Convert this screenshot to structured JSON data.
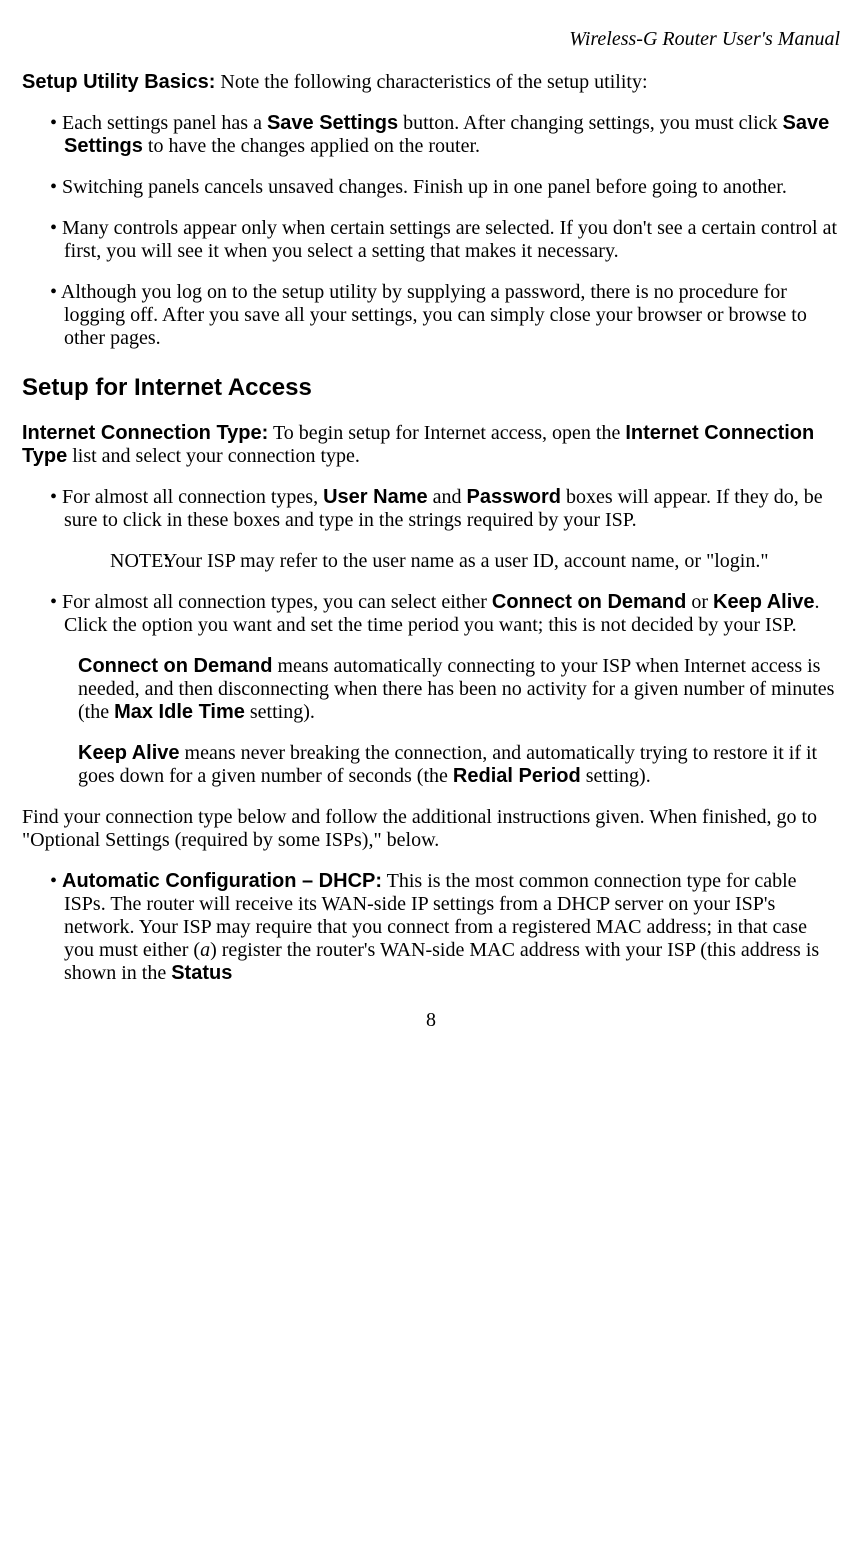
{
  "header": {
    "title": "Wireless-G Router User's Manual"
  },
  "setup_basics": {
    "lead": "Setup Utility Basics:",
    "intro_rest": " Note the following characteristics of the setup utility:",
    "bullets": [
      {
        "pre": "Each settings panel has a ",
        "b1": "Save Settings",
        "mid": " button. After changing settings, you must click ",
        "b2": "Save Settings",
        "post": " to have the changes applied on the router."
      },
      {
        "text": "Switching panels cancels unsaved changes. Finish up in one panel before going to another."
      },
      {
        "text": "Many controls appear only when certain settings are selected. If you don't see a certain control at first, you will see it when you select a setting that makes it necessary."
      },
      {
        "text": "Although you log on to the setup utility by supplying a password, there is no procedure for logging off. After you save all your settings, you can simply close your browser or browse to other pages."
      }
    ]
  },
  "section2": {
    "heading": "Setup for Internet Access",
    "ict": {
      "lead": "Internet Connection Type:",
      "p1a": " To begin setup for Internet access, open the ",
      "b1": "Internet Connection Type",
      "p1b": " list and select your connection type."
    },
    "bullets1": {
      "b1": {
        "pre": "For almost all connection types, ",
        "s1": "User Name",
        "mid1": " and ",
        "s2": "Password",
        "post": " boxes will appear. If they do, be sure to click in these boxes and type in the strings required by your ISP."
      },
      "note": {
        "label": "NOTE:",
        "body": "Your ISP may refer to the user name as a user ID, account name, or \"login.\""
      },
      "b2": {
        "pre": "For almost all connection types, you can select either ",
        "s1": "Connect on Demand",
        "mid1": " or ",
        "s2": "Keep Alive",
        "post": ". Click the option you want and set the time period you want; this is not decided by your ISP."
      },
      "b2_sub1": {
        "s1": "Connect on Demand",
        "mid": " means automatically connecting to your ISP when Internet access is needed, and then disconnecting when there has been no activity for a given number of minutes (the ",
        "s2": "Max Idle Time",
        "post": " setting)."
      },
      "b2_sub2": {
        "s1": "Keep Alive",
        "mid": " means never breaking the connection, and automatically trying to restore it if it goes down for a given number of seconds (the ",
        "s2": "Redial Period",
        "post": " setting)."
      }
    },
    "plain": "Find your connection type below and follow the additional instructions given. When finished, go to \"Optional Settings (required by some ISPs),\" below.",
    "bullets2": {
      "dhcp": {
        "lead": "Automatic Configuration – DHCP:",
        "p1": " This is the most common connection type for cable ISPs. The router will receive its WAN-side IP settings from a DHCP server on your ISP's network. Your ISP may require that you connect from a registered MAC address; in that case you must either (",
        "ital": "a",
        "p2": ") register the router's WAN-side MAC address with your ISP (this address is shown in the ",
        "s1": "Status"
      }
    }
  },
  "page_number": "8"
}
